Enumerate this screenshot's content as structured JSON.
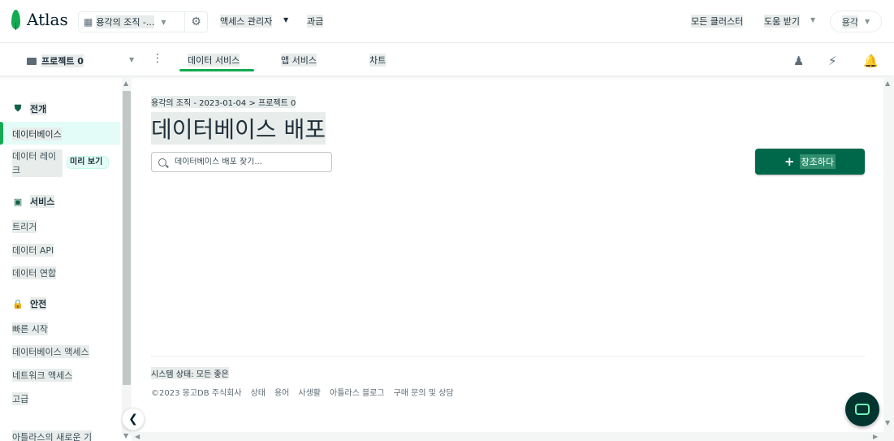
{
  "topbar": {
    "logo_text": "Atlas",
    "org_name": "용각의 조직 -...",
    "links": [
      "액세스 관리자",
      "과금"
    ],
    "all_clusters": "모든 클러스터",
    "help": "도움 받기",
    "user": "용각"
  },
  "projectbar": {
    "project": "프로젝트 0",
    "tabs": [
      "데이터 서비스",
      "앱 서비스",
      "차트"
    ],
    "active_tab": "데이터 서비스"
  },
  "sidebar": {
    "overview": "전개",
    "database": "데이터베이스",
    "data_lake": "데이터 레이크",
    "preview_badge": "미리 보기",
    "services_header": "서비스",
    "services": [
      "트리거",
      "데이터 API",
      "데이터 연합"
    ],
    "security_header": "안전",
    "security": [
      "빠른 시작",
      "데이터베이스 액세스",
      "네트워크 액세스",
      "고급"
    ],
    "whats_new": "아틀라스의 새로운 기"
  },
  "main": {
    "breadcrumb": "용각의 조직 - 2023-01-04 > 프로젝트 0",
    "title": "데이터베이스 배포",
    "search_placeholder": "데이터베이스 배포 찾기...",
    "create_button": "창조하다",
    "system_status_label": "시스템 상태:",
    "system_status_value": "모든 좋은",
    "footer": [
      "©2023 몽고DB 주식회사",
      "상태",
      "용어",
      "사생활",
      "아틀라스 블로그",
      "구매 문의 및 상담"
    ]
  },
  "colors": {
    "brand_green": "#13aa52",
    "button_green": "#00684a",
    "active_bg": "#e3fcf7",
    "chat_bg": "#023430"
  }
}
